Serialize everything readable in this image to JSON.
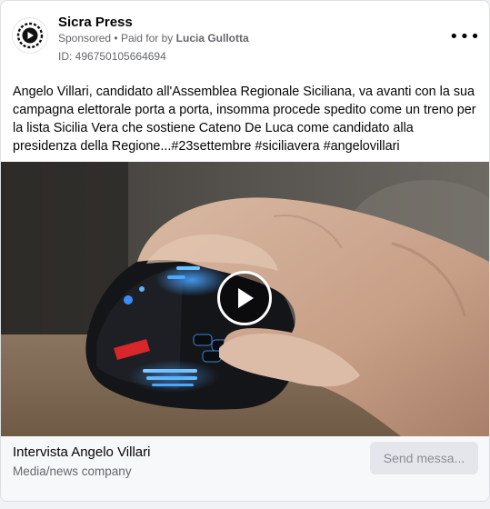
{
  "post": {
    "page_name": "Sicra Press",
    "sponsored_label": "Sponsored",
    "paid_for_prefix": "Paid for by",
    "payer": "Lucia Gullotta",
    "separator": "•",
    "id_label": "ID: 496750105664694",
    "more_icon": "more-horizontal-icon",
    "more_glyph": "•••",
    "body_text": "Angelo Villari, candidato all'Assemblea Regionale Siciliana, va avanti con la sua campagna elettorale porta a porta, insomma procede spedito come un treno per la lista Sicilia Vera che sostiene Cateno De Luca come candidato alla presidenza della Regione...#23settembre #siciliavera #angelovillari"
  },
  "media": {
    "type": "video",
    "description_icon": "play-icon"
  },
  "footer": {
    "title": "Intervista Angelo Villari",
    "subtitle": "Media/news company",
    "cta_label": "Send messa..."
  },
  "colors": {
    "accent_blue": "#1877f2",
    "text_primary": "#050505",
    "text_secondary": "#65676b",
    "cta_bg": "#e4e6eb"
  }
}
